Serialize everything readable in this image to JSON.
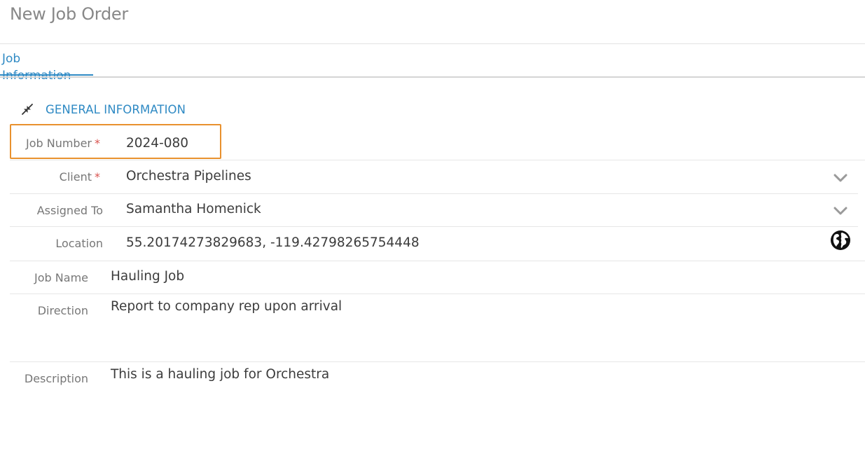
{
  "page": {
    "title": "New Job Order"
  },
  "tabs": [
    {
      "label": "Job Information"
    }
  ],
  "section": {
    "title": "GENERAL INFORMATION"
  },
  "fields": {
    "job_number": {
      "label": "Job Number",
      "required_mark": "*",
      "value": "2024-080"
    },
    "client": {
      "label": "Client",
      "required_mark": "*",
      "value": "Orchestra Pipelines"
    },
    "assigned_to": {
      "label": "Assigned To",
      "value": "Samantha Homenick"
    },
    "location": {
      "label": "Location",
      "value": "55.20174273829683, -119.42798265754448"
    },
    "job_name": {
      "label": "Job Name",
      "value": "Hauling Job"
    },
    "direction": {
      "label": "Direction",
      "value": "Report to company rep upon arrival"
    },
    "description": {
      "label": "Description",
      "value": "This is a hauling job for Orchestra"
    }
  },
  "icons": {
    "collapse": "collapse-arrows-icon",
    "dropdown": "chevron-down-icon",
    "map": "globe-icon"
  },
  "colors": {
    "accent": "#2f8ac4",
    "required": "#d9534f",
    "highlight": "#e8912e"
  }
}
